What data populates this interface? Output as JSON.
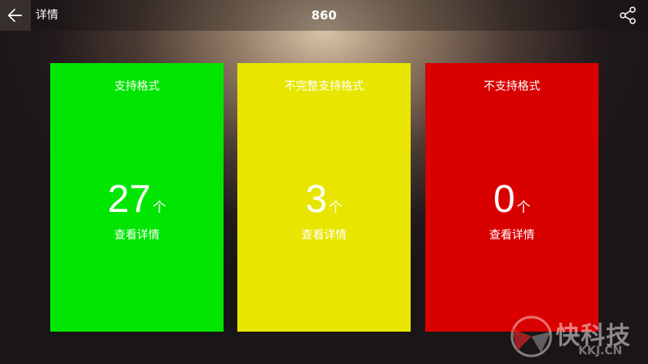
{
  "header": {
    "label": "详情",
    "title": "860",
    "back_icon": "arrow-left-icon",
    "share_icon": "share-icon"
  },
  "cards": [
    {
      "title": "支持格式",
      "count": "27",
      "unit": "个",
      "link": "查看详情",
      "color": "#00e600"
    },
    {
      "title": "不完整支持格式",
      "count": "3",
      "unit": "个",
      "link": "查看详情",
      "color": "#e8e600"
    },
    {
      "title": "不支持格式",
      "count": "0",
      "unit": "个",
      "link": "查看详情",
      "color": "#d90000"
    }
  ],
  "watermark": {
    "text": "快科技",
    "sub": "KKJ.CN"
  }
}
